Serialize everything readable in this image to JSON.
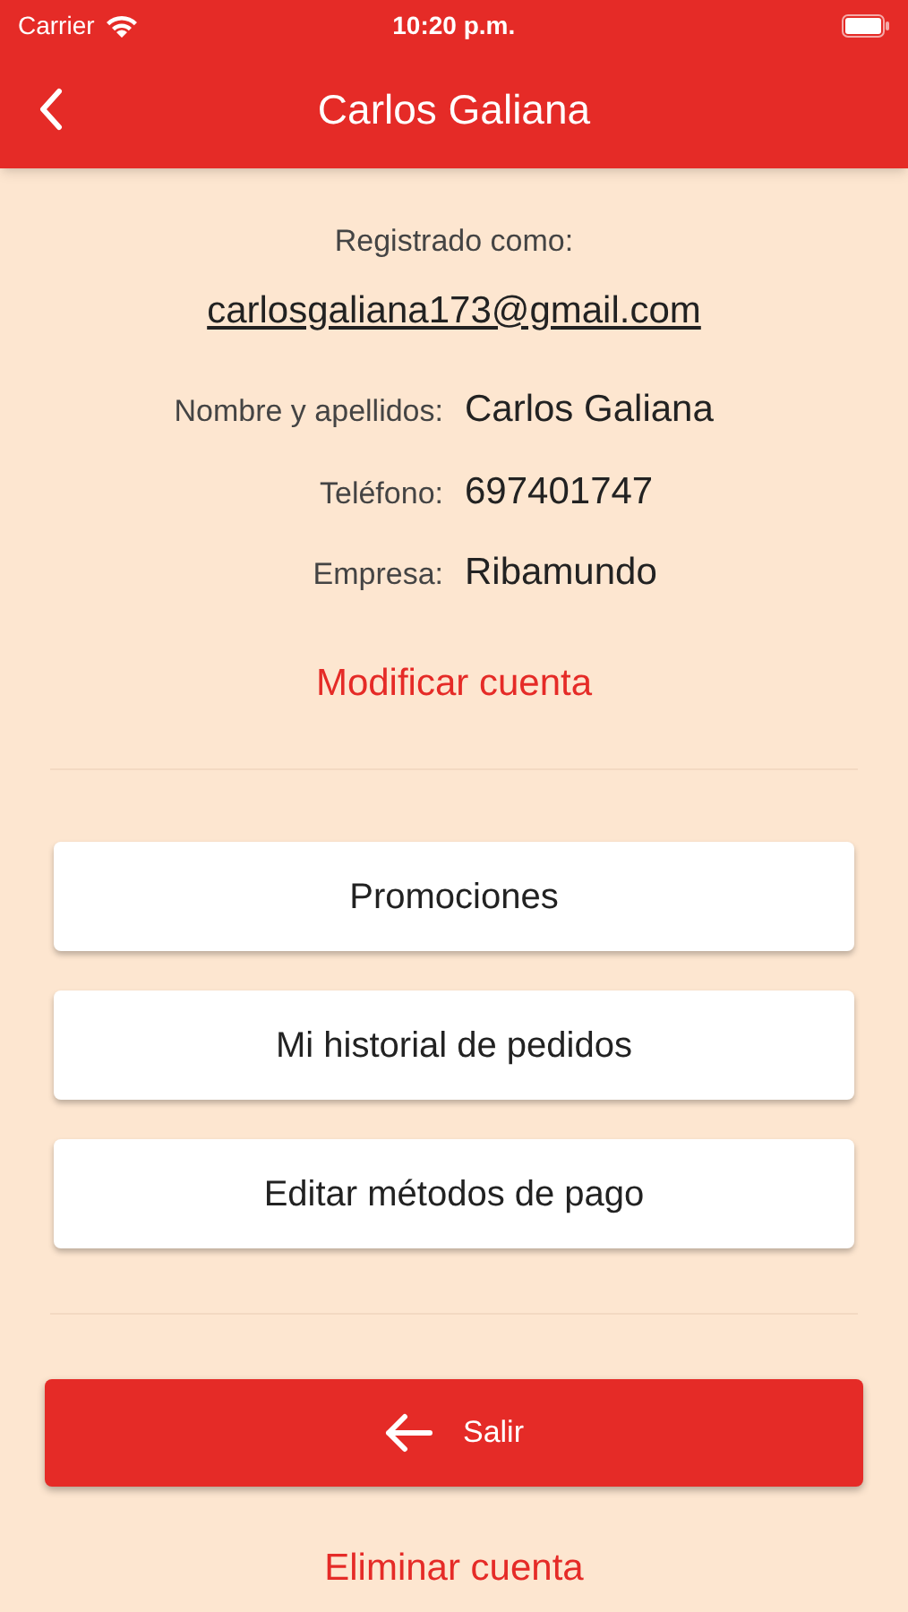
{
  "status_bar": {
    "carrier": "Carrier",
    "time": "10:20 p.m."
  },
  "header": {
    "title": "Carlos Galiana"
  },
  "account": {
    "registered_label": "Registrado como:",
    "email": "carlosgaliana173@gmail.com",
    "fields": [
      {
        "label": "Nombre y apellidos:",
        "value": "Carlos Galiana"
      },
      {
        "label": "Teléfono:",
        "value": "697401747"
      },
      {
        "label": "Empresa:",
        "value": "Ribamundo"
      }
    ],
    "modify_link": "Modificar cuenta"
  },
  "menu": [
    {
      "label": "Promociones"
    },
    {
      "label": "Mi historial de pedidos"
    },
    {
      "label": "Editar métodos de pago"
    }
  ],
  "logout_button": "Salir",
  "delete_link": "Eliminar cuenta"
}
